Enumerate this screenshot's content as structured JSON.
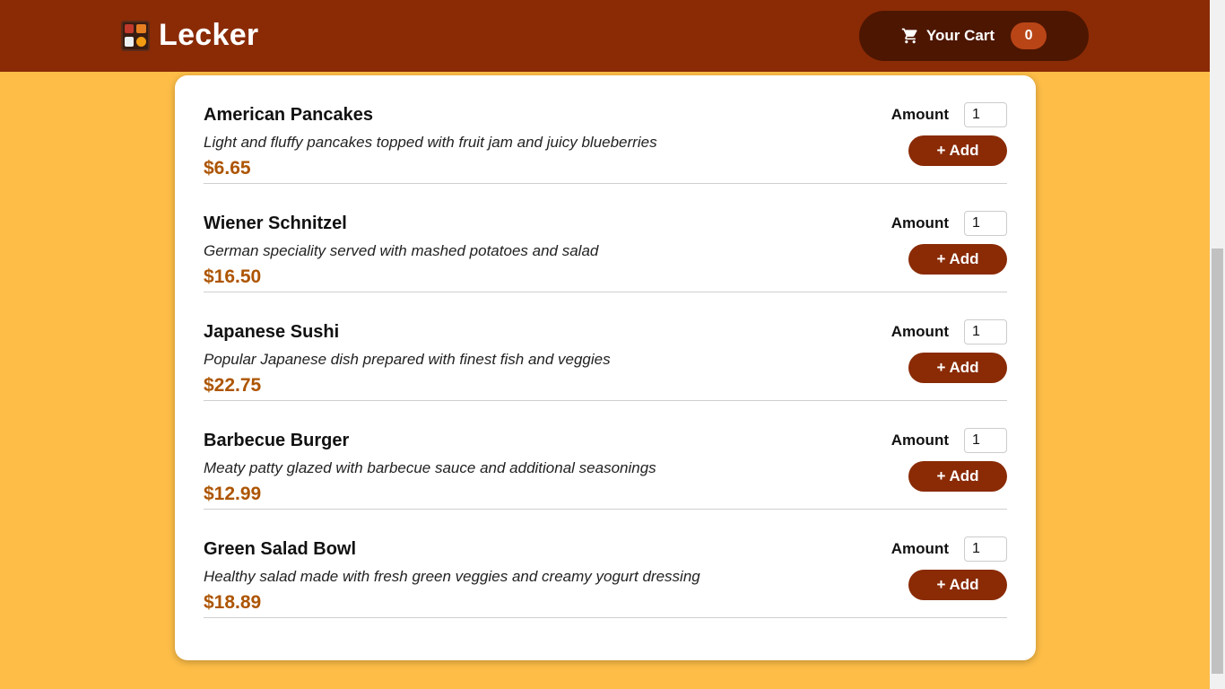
{
  "app": {
    "title": "Lecker"
  },
  "cart": {
    "label": "Your Cart",
    "count": "0"
  },
  "amount_label": "Amount",
  "add_label": "+ Add",
  "meals": [
    {
      "name": "American Pancakes",
      "description": "Light and fluffy pancakes topped with fruit jam and juicy blueberries",
      "price": "$6.65",
      "amount": "1"
    },
    {
      "name": "Wiener Schnitzel",
      "description": "German speciality served with mashed potatoes and salad",
      "price": "$16.50",
      "amount": "1"
    },
    {
      "name": "Japanese Sushi",
      "description": "Popular Japanese dish prepared with finest fish and veggies",
      "price": "$22.75",
      "amount": "1"
    },
    {
      "name": "Barbecue Burger",
      "description": "Meaty patty glazed with barbecue sauce and additional seasonings",
      "price": "$12.99",
      "amount": "1"
    },
    {
      "name": "Green Salad Bowl",
      "description": "Healthy salad made with fresh green veggies and creamy yogurt dressing",
      "price": "$18.89",
      "amount": "1"
    }
  ],
  "colors": {
    "header": "#8a2b06",
    "background": "#fdbd47",
    "price": "#ad5502",
    "cart_button": "#4d1601",
    "badge": "#b94517"
  },
  "icons": {
    "logo": "bento-box-icon",
    "cart": "cart-icon"
  }
}
